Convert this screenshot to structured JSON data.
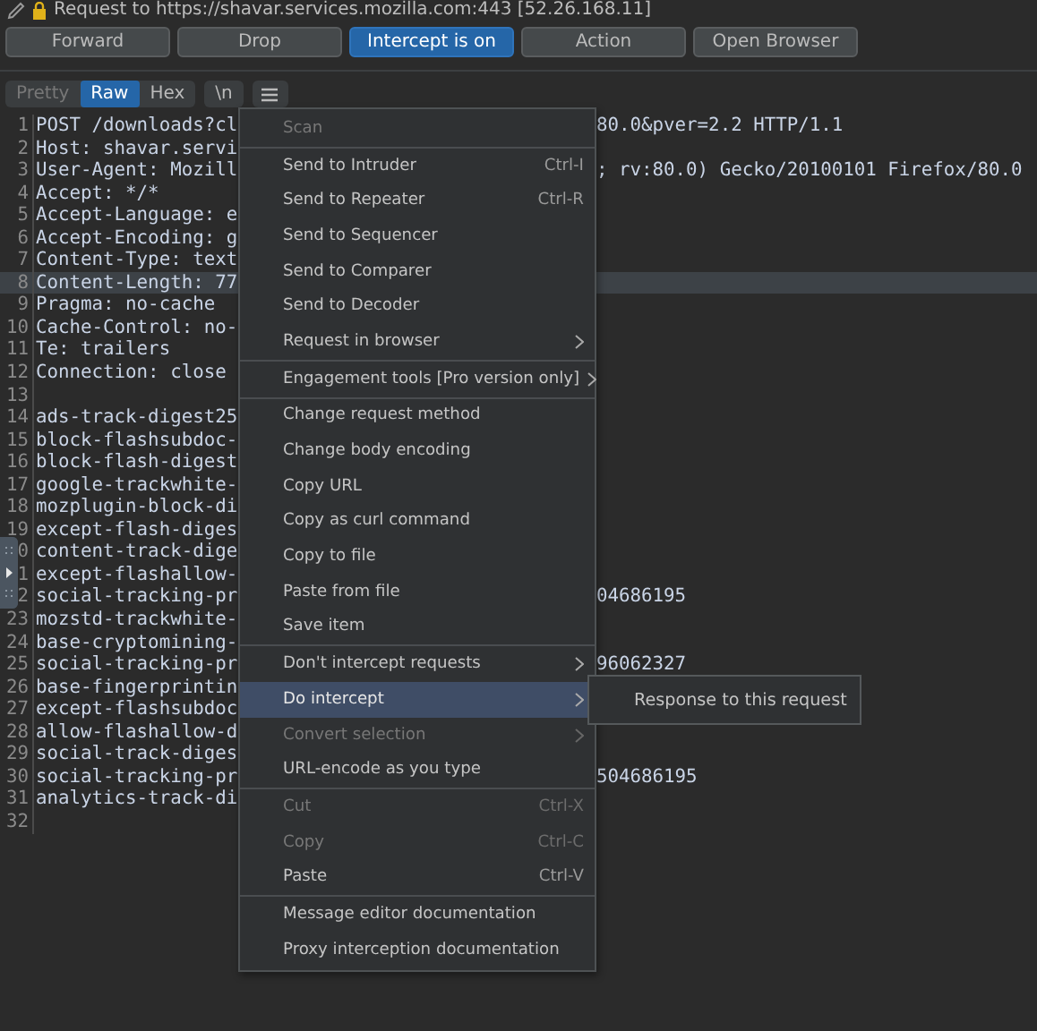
{
  "title": {
    "text": "Request to https://shavar.services.mozilla.com:443  [52.26.168.11]"
  },
  "buttons": [
    {
      "label": "Forward",
      "selected": false
    },
    {
      "label": "Drop",
      "selected": false
    },
    {
      "label": "Intercept is on",
      "selected": true
    },
    {
      "label": "Action",
      "selected": false
    },
    {
      "label": "Open Browser",
      "selected": false
    }
  ],
  "tabs": [
    {
      "label": "Pretty",
      "selected": false,
      "disabled": true
    },
    {
      "label": "Raw",
      "selected": true,
      "disabled": false
    },
    {
      "label": "Hex",
      "selected": false,
      "disabled": false
    }
  ],
  "newline_toggle": {
    "label": "\\n"
  },
  "editor": {
    "lines": [
      {
        "number": "1",
        "text": "POST /downloads?cl",
        "tail": "80.0&pver=2.2 HTTP/1.1",
        "selected": false
      },
      {
        "number": "2",
        "text": "Host: shavar.servi",
        "selected": false
      },
      {
        "number": "3",
        "text": "User-Agent: Mozill",
        "tail": "; rv:80.0) Gecko/20100101 Firefox/80.0",
        "selected": false
      },
      {
        "number": "4",
        "text": "Accept: */*",
        "selected": false
      },
      {
        "number": "5",
        "text": "Accept-Language: e",
        "selected": false
      },
      {
        "number": "6",
        "text": "Accept-Encoding: g",
        "selected": false
      },
      {
        "number": "7",
        "text": "Content-Type: text",
        "selected": false
      },
      {
        "number": "8",
        "text": "Content-Length: 77",
        "selected": true
      },
      {
        "number": "9",
        "text": "Pragma: no-cache",
        "selected": false
      },
      {
        "number": "10",
        "text": "Cache-Control: no-",
        "selected": false
      },
      {
        "number": "11",
        "text": "Te: trailers",
        "selected": false
      },
      {
        "number": "12",
        "text": "Connection: close",
        "selected": false
      },
      {
        "number": "13",
        "selected": false
      },
      {
        "number": "14",
        "text": "ads-track-digest25",
        "selected": false
      },
      {
        "number": "15",
        "text": "block-flashsubdoc-",
        "selected": false
      },
      {
        "number": "16",
        "text": "block-flash-digest",
        "selected": false
      },
      {
        "number": "17",
        "text": "google-trackwhite-",
        "selected": false
      },
      {
        "number": "18",
        "text": "mozplugin-block-di",
        "selected": false
      },
      {
        "number": "19",
        "text": "except-flash-diges",
        "selected": false
      },
      {
        "number": "0",
        "text": "content-track-dige",
        "selected": false
      },
      {
        "number": "1",
        "text": "except-flashallow-",
        "selected": false
      },
      {
        "number": "2",
        "text": "social-tracking-pr",
        "tail": "04686195",
        "selected": false
      },
      {
        "number": "23",
        "text": "mozstd-trackwhite-",
        "selected": false
      },
      {
        "number": "24",
        "text": "base-cryptomining-",
        "selected": false
      },
      {
        "number": "25",
        "text": "social-tracking-pr",
        "tail": "96062327",
        "selected": false
      },
      {
        "number": "26",
        "text": "base-fingerprintin",
        "selected": false
      },
      {
        "number": "27",
        "text": "except-flashsubdoc",
        "selected": false
      },
      {
        "number": "28",
        "text": "allow-flashallow-d",
        "selected": false
      },
      {
        "number": "29",
        "text": "social-track-diges",
        "selected": false
      },
      {
        "number": "30",
        "text": "social-tracking-pr",
        "tail": "504686195",
        "selected": false
      },
      {
        "number": "31",
        "text": "analytics-track-di",
        "selected": false
      },
      {
        "number": "32",
        "selected": false
      }
    ]
  },
  "context_menu": {
    "items": [
      {
        "kind": "item",
        "label": "Scan",
        "disabled": true,
        "selected": false,
        "submenu": false
      },
      {
        "kind": "separator"
      },
      {
        "kind": "item",
        "label": "Send to Intruder",
        "shortcut": "Ctrl-I",
        "disabled": false,
        "selected": false,
        "submenu": false
      },
      {
        "kind": "item",
        "label": "Send to Repeater",
        "shortcut": "Ctrl-R",
        "disabled": false,
        "selected": false,
        "submenu": false
      },
      {
        "kind": "item",
        "label": "Send to Sequencer",
        "disabled": false,
        "selected": false,
        "submenu": false
      },
      {
        "kind": "item",
        "label": "Send to Comparer",
        "disabled": false,
        "selected": false,
        "submenu": false
      },
      {
        "kind": "item",
        "label": "Send to Decoder",
        "disabled": false,
        "selected": false,
        "submenu": false
      },
      {
        "kind": "item",
        "label": "Request in browser",
        "disabled": false,
        "selected": false,
        "submenu": true
      },
      {
        "kind": "separator"
      },
      {
        "kind": "item",
        "label": "Engagement tools [Pro version only]",
        "disabled": false,
        "selected": false,
        "submenu": true
      },
      {
        "kind": "separator"
      },
      {
        "kind": "item",
        "label": "Change request method",
        "disabled": false,
        "selected": false,
        "submenu": false
      },
      {
        "kind": "item",
        "label": "Change body encoding",
        "disabled": false,
        "selected": false,
        "submenu": false
      },
      {
        "kind": "item",
        "label": "Copy URL",
        "disabled": false,
        "selected": false,
        "submenu": false
      },
      {
        "kind": "item",
        "label": "Copy as curl command",
        "disabled": false,
        "selected": false,
        "submenu": false
      },
      {
        "kind": "item",
        "label": "Copy to file",
        "disabled": false,
        "selected": false,
        "submenu": false
      },
      {
        "kind": "item",
        "label": "Paste from file",
        "disabled": false,
        "selected": false,
        "submenu": false
      },
      {
        "kind": "item",
        "label": "Save item",
        "disabled": false,
        "selected": false,
        "submenu": false
      },
      {
        "kind": "separator"
      },
      {
        "kind": "item",
        "label": "Don't intercept requests",
        "disabled": false,
        "selected": false,
        "submenu": true
      },
      {
        "kind": "item",
        "label": "Do intercept",
        "disabled": false,
        "selected": true,
        "submenu": true
      },
      {
        "kind": "item",
        "label": "Convert selection",
        "disabled": true,
        "selected": false,
        "submenu": true
      },
      {
        "kind": "item",
        "label": "URL-encode as you type",
        "disabled": false,
        "selected": false,
        "submenu": false
      },
      {
        "kind": "separator"
      },
      {
        "kind": "item",
        "label": "Cut",
        "shortcut": "Ctrl-X",
        "disabled": true,
        "selected": false,
        "submenu": false
      },
      {
        "kind": "item",
        "label": "Copy",
        "shortcut": "Ctrl-C",
        "disabled": true,
        "selected": false,
        "submenu": false
      },
      {
        "kind": "item",
        "label": "Paste",
        "shortcut": "Ctrl-V",
        "disabled": false,
        "selected": false,
        "submenu": false
      },
      {
        "kind": "separator"
      },
      {
        "kind": "item",
        "label": "Message editor documentation",
        "disabled": false,
        "selected": false,
        "submenu": false
      },
      {
        "kind": "item",
        "label": "Proxy interception documentation",
        "disabled": false,
        "selected": false,
        "submenu": false
      }
    ]
  },
  "submenu": {
    "items": [
      {
        "label": "Response to this request"
      }
    ]
  }
}
